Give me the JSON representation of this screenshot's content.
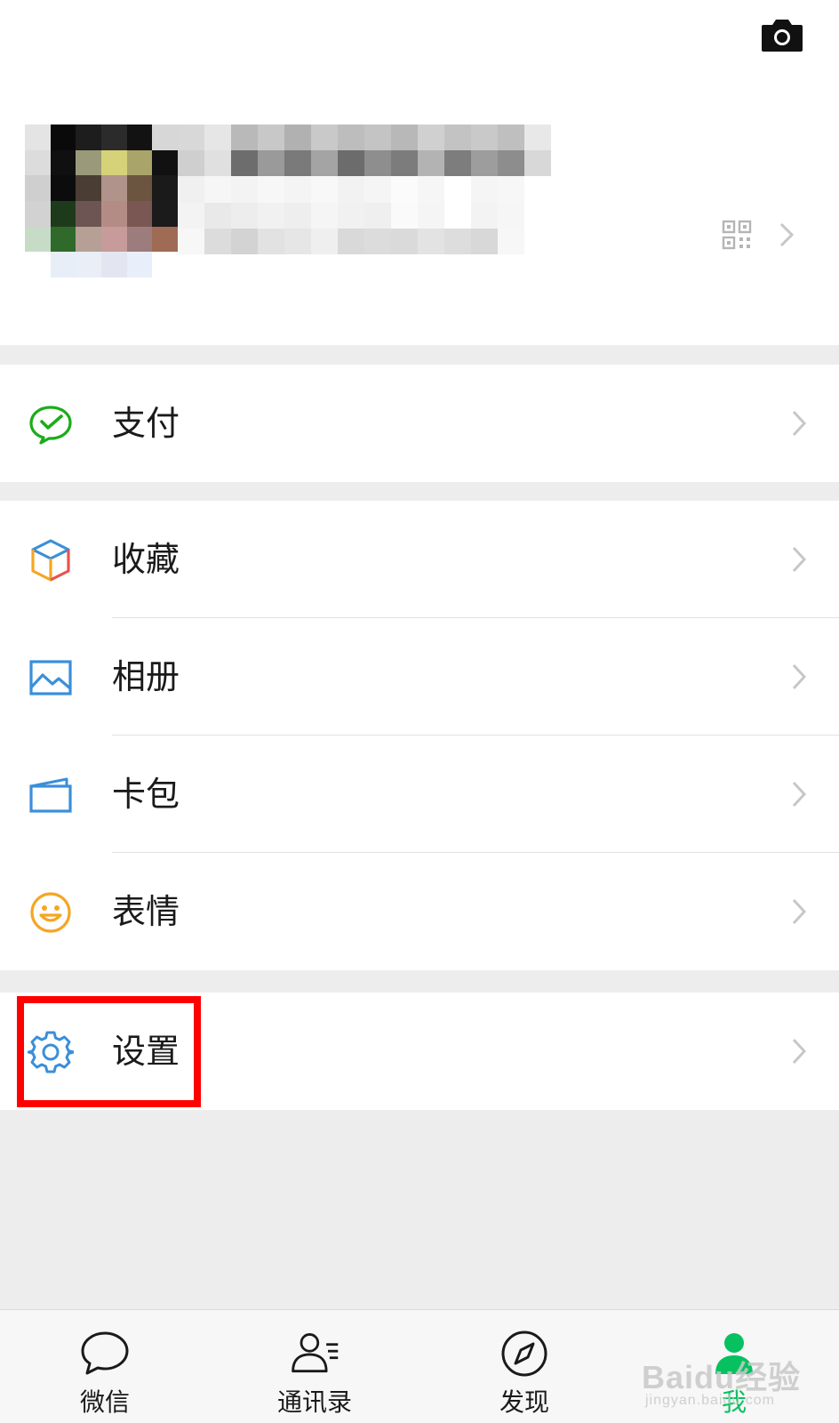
{
  "profile": {
    "camera_icon": "camera-icon",
    "qr_icon": "qr-code-icon",
    "chevron_icon": "chevron-right-icon"
  },
  "menu": {
    "groups": [
      [
        {
          "label": "支付",
          "icon": "wechat-pay-icon"
        }
      ],
      [
        {
          "label": "收藏",
          "icon": "favorites-cube-icon"
        },
        {
          "label": "相册",
          "icon": "album-picture-icon"
        },
        {
          "label": "卡包",
          "icon": "card-wallet-icon"
        },
        {
          "label": "表情",
          "icon": "smiley-emoji-icon"
        }
      ],
      [
        {
          "label": "设置",
          "icon": "settings-gear-icon"
        }
      ]
    ]
  },
  "tabbar": {
    "tabs": [
      {
        "label": "微信",
        "icon": "chat-bubble-icon",
        "active": false
      },
      {
        "label": "通讯录",
        "icon": "contacts-icon",
        "active": false
      },
      {
        "label": "发现",
        "icon": "discover-compass-icon",
        "active": false
      },
      {
        "label": "我",
        "icon": "me-person-icon",
        "active": true
      }
    ]
  },
  "watermark": {
    "text": "Baidu经验",
    "subtext": "jingyan.baidu.com"
  },
  "colors": {
    "accent": "#07c160",
    "highlight": "#ff0000",
    "pay_green": "#1aad19",
    "blue": "#3a8fd9",
    "orange": "#f5a623"
  }
}
